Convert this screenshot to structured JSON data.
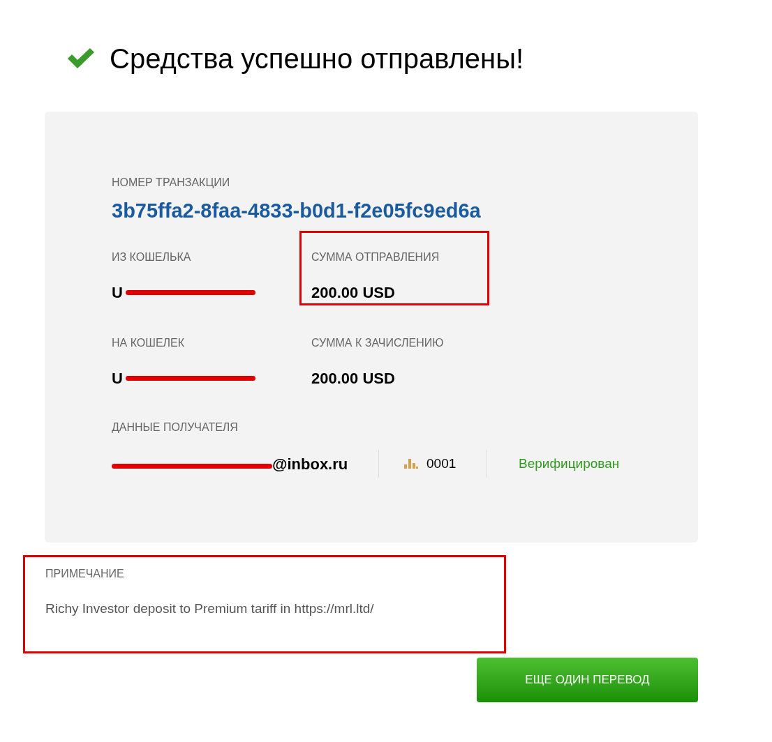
{
  "title": "Средства успешно отправлены!",
  "transaction": {
    "label": "НОМЕР ТРАНЗАКЦИИ",
    "value": "3b75ffa2-8faa-4833-b0d1-f2e05fc9ed6a"
  },
  "fields": [
    {
      "label": "ИЗ КОШЕЛЬКА",
      "value": "U",
      "redacted": true,
      "highlighted": false
    },
    {
      "label": "СУММА ОТПРАВЛЕНИЯ",
      "value": "200.00 USD",
      "redacted": false,
      "highlighted": true
    },
    {
      "label": "НА КОШЕЛЕК",
      "value": "U",
      "redacted": true,
      "highlighted": false
    },
    {
      "label": "СУММА К ЗАЧИСЛЕНИЮ",
      "value": "200.00 USD",
      "redacted": false,
      "highlighted": false
    }
  ],
  "recipient": {
    "label": "ДАННЫЕ ПОЛУЧАТЕЛЯ",
    "email": "@inbox.ru",
    "redacted": true,
    "rating": "0001",
    "status": "Верифицирован"
  },
  "note": {
    "label": "ПРИМЕЧАНИЕ",
    "text": "Richy Investor deposit to Premium tariff in https://mrl.ltd/",
    "highlighted": true
  },
  "button": "ЕЩЕ ОДИН ПЕРЕВОД"
}
